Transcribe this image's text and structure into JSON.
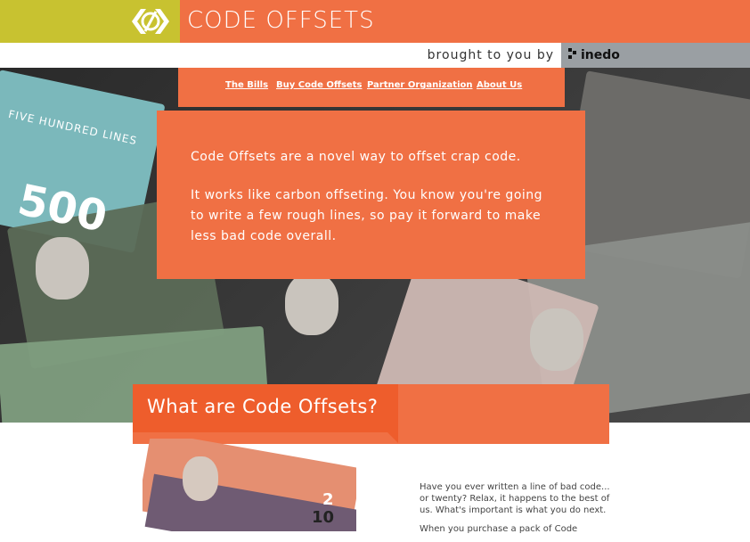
{
  "header": {
    "title": "CODE OFFSETS",
    "logo_icon": "code-offsets-logo-icon",
    "sponsor_prefix": "brought to you by",
    "sponsor_name": "inedo",
    "colors": {
      "orange": "#f07044",
      "olive": "#c8c230",
      "deep_orange": "#ee5d2c",
      "sponsor_gray": "#9a9fa3"
    }
  },
  "nav": {
    "items": [
      {
        "label": "The Bills"
      },
      {
        "label": "Buy Code Offsets"
      },
      {
        "label": "Partner Organization"
      },
      {
        "label": "About Us"
      }
    ]
  },
  "hero": {
    "bill_number": "500",
    "bill_text": "FIVE HUNDRED LINES"
  },
  "intro": {
    "p1": "Code Offsets are a novel way to offset crap code.",
    "p2": "It works like carbon offseting. You know you're going to write a few rough lines, so pay it forward to make less bad code overall."
  },
  "section": {
    "title": "What are Code Offsets?",
    "illustration_values": [
      "2",
      "10"
    ],
    "paragraphs": [
      "Have you ever written a line of bad code... or twenty? Relax, it happens to the best of us. What's important is what you do next.",
      "When you purchase a pack of Code"
    ]
  }
}
